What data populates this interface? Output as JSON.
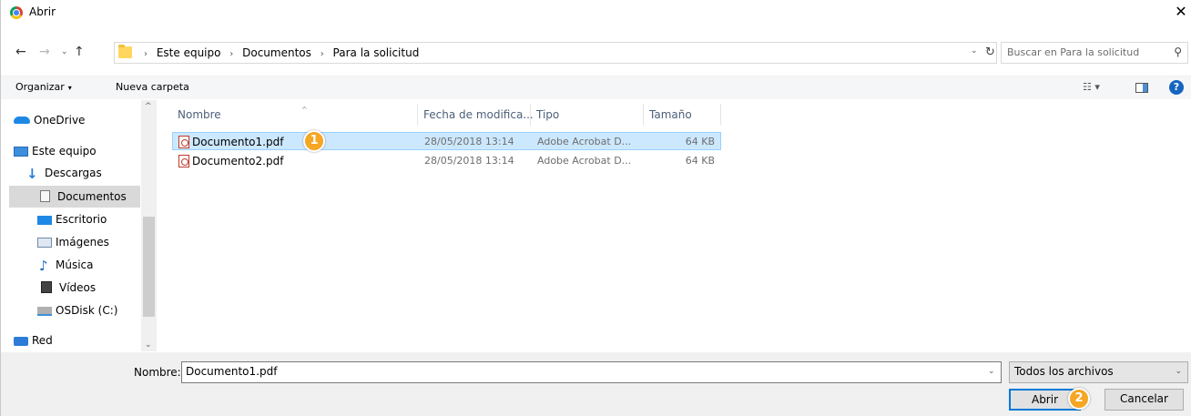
{
  "window": {
    "title": "Abrir",
    "close_glyph": "✕"
  },
  "nav": {
    "back_glyph": "←",
    "forward_glyph": "→",
    "recent_glyph": "⌄",
    "up_glyph": "↑",
    "breadcrumb": [
      "Este equipo",
      "Documentos",
      "Para la solicitud"
    ],
    "breadcrumb_sep": "›",
    "refresh_glyph": "↻",
    "dropdown_glyph": "⌄"
  },
  "search": {
    "placeholder": "Buscar en Para la solicitud",
    "icon_glyph": "⚲"
  },
  "toolbar": {
    "organize_label": "Organizar",
    "organize_caret": "▾",
    "new_folder_label": "Nueva carpeta",
    "view_glyph": "☷ ▾",
    "help_glyph": "?"
  },
  "sidebar": {
    "items": [
      {
        "label": "OneDrive",
        "icon": "onedrive-icon"
      },
      {
        "label": "Este equipo",
        "icon": "computer-icon"
      },
      {
        "label": "Descargas",
        "icon": "downloads-icon"
      },
      {
        "label": "Documentos",
        "icon": "documents-icon",
        "selected": true
      },
      {
        "label": "Escritorio",
        "icon": "desktop-icon"
      },
      {
        "label": "Imágenes",
        "icon": "pictures-icon"
      },
      {
        "label": "Música",
        "icon": "music-icon"
      },
      {
        "label": "Vídeos",
        "icon": "videos-icon"
      },
      {
        "label": "OSDisk (C:)",
        "icon": "disk-icon"
      },
      {
        "label": "Red",
        "icon": "network-icon"
      }
    ],
    "scroll_up_glyph": "^",
    "scroll_down_glyph": "⌄"
  },
  "columns": [
    "Nombre",
    "Fecha de modifica...",
    "Tipo",
    "Tamaño"
  ],
  "sort_glyph": "^",
  "files": [
    {
      "name": "Documento1.pdf",
      "date": "28/05/2018 13:14",
      "type": "Adobe Acrobat D...",
      "size": "64 KB",
      "selected": true
    },
    {
      "name": "Documento2.pdf",
      "date": "28/05/2018 13:14",
      "type": "Adobe Acrobat D...",
      "size": "64 KB",
      "selected": false
    }
  ],
  "badges": {
    "one": "1",
    "two": "2"
  },
  "bottom": {
    "name_label": "Nombre:",
    "name_value": "Documento1.pdf",
    "filter_value": "Todos los archivos",
    "dropdown_glyph": "⌄",
    "open_label": "Abrir",
    "cancel_label": "Cancelar"
  },
  "colors": {
    "selection": "#cce8ff",
    "accent": "#0078d7",
    "badge": "#f5a623"
  }
}
